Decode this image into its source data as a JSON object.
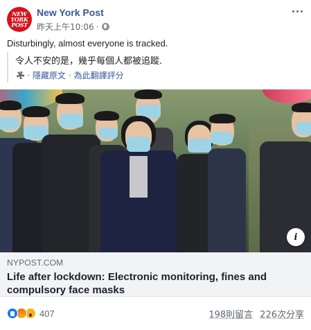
{
  "page": {
    "name": "New York Post",
    "avatar_lines": [
      "NEW",
      "YORK",
      "POST"
    ],
    "timestamp": "昨天上午10:06",
    "privacy_icon": "globe-icon",
    "brand_color": "#d9101a",
    "link_color": "#385898"
  },
  "post": {
    "text": "Disturbingly, almost everyone is tracked.",
    "translated_text": "令人不安的是，幾乎每個人都被追蹤.",
    "hide_original_label": "隱藏原文",
    "separator": "·",
    "rate_translation_label": "為此翻譯評分"
  },
  "link_preview": {
    "domain": "NYPOST.COM",
    "headline": "Life after lockdown: Electronic monitoring, fines and compulsory face masks"
  },
  "footer": {
    "reaction_count": "407",
    "comments_label": "198則留言",
    "shares_label": "226次分享"
  }
}
